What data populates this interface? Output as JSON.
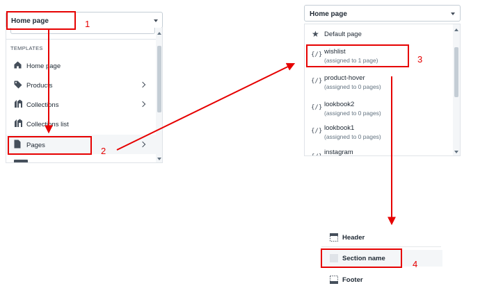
{
  "left_select": {
    "value": "Home page"
  },
  "left_list": {
    "section_header": "TEMPLATES",
    "items": [
      {
        "label": "Home page",
        "icon": "home-icon",
        "has_chevron": false
      },
      {
        "label": "Products",
        "icon": "tag-icon",
        "has_chevron": true
      },
      {
        "label": "Collections",
        "icon": "collections-icon",
        "has_chevron": true
      },
      {
        "label": "Collections list",
        "icon": "collections-list-icon",
        "has_chevron": false
      },
      {
        "label": "Pages",
        "icon": "page-icon",
        "has_chevron": true
      }
    ]
  },
  "right_select": {
    "value": "Home page"
  },
  "right_list": {
    "items": [
      {
        "label": "Default page",
        "sub": "",
        "icon": "star-icon"
      },
      {
        "label": "wishlist",
        "sub": "(assigned to 1 page)",
        "icon": "code-icon"
      },
      {
        "label": "product-hover",
        "sub": "(assigned to 0 pages)",
        "icon": "code-icon"
      },
      {
        "label": "lookbook2",
        "sub": "(assigned to 0 pages)",
        "icon": "code-icon"
      },
      {
        "label": "lookbook1",
        "sub": "(assigned to 0 pages)",
        "icon": "code-icon"
      },
      {
        "label": "instagram",
        "sub": "",
        "icon": "code-icon"
      }
    ]
  },
  "sections": {
    "items": [
      {
        "label": "Header",
        "icon": "header-icon"
      },
      {
        "label": "Section name",
        "icon": "section-icon"
      },
      {
        "label": "Footer",
        "icon": "footer-icon"
      }
    ]
  },
  "annotations": {
    "step1": "1",
    "step2": "2",
    "step3": "3",
    "step4": "4"
  },
  "colors": {
    "annotation": "#e60000",
    "highlight": "#f4f6f8",
    "icon": "#454f5b"
  }
}
